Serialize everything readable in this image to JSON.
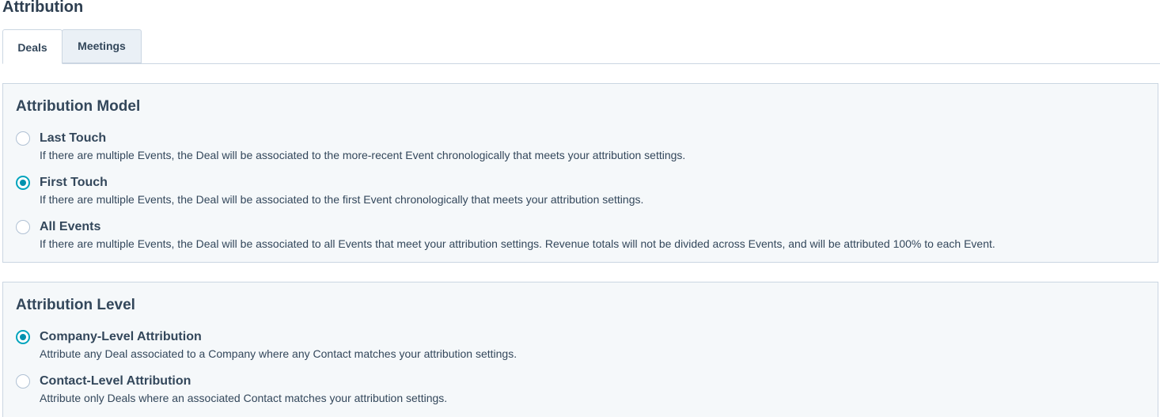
{
  "page": {
    "title": "Attribution"
  },
  "tabs": [
    {
      "label": "Deals",
      "active": true
    },
    {
      "label": "Meetings",
      "active": false
    }
  ],
  "attribution_model": {
    "title": "Attribution Model",
    "options": [
      {
        "label": "Last Touch",
        "description": "If there are multiple Events, the Deal will be associated to the more-recent Event chronologically that meets your attribution settings.",
        "checked": false
      },
      {
        "label": "First Touch",
        "description": "If there are multiple Events, the Deal will be associated to the first Event chronologically that meets your attribution settings.",
        "checked": true
      },
      {
        "label": "All Events",
        "description": "If there are multiple Events, the Deal will be associated to all Events that meet your attribution settings. Revenue totals will not be divided across Events, and will be attributed 100% to each Event.",
        "checked": false
      }
    ]
  },
  "attribution_level": {
    "title": "Attribution Level",
    "options": [
      {
        "label": "Company-Level Attribution",
        "description": "Attribute any Deal associated to a Company where any Contact matches your attribution settings.",
        "checked": true
      },
      {
        "label": "Contact-Level Attribution",
        "description": "Attribute only Deals where an associated Contact matches your attribution settings.",
        "checked": false
      }
    ]
  },
  "colors": {
    "text": "#33475b",
    "accent": "#00a4bd",
    "card_background": "#f5f8fa",
    "border": "#cbd6e2",
    "inactive_tab": "#eaf0f6"
  }
}
